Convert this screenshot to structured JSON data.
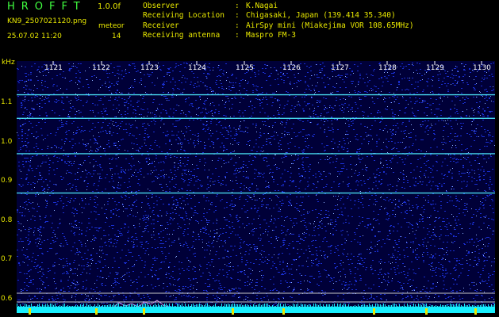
{
  "header": {
    "app_title": "HROFFT",
    "version": "1.0.0f",
    "filename": "KN9_2507021120.png",
    "datetime": "25.07.02 11:20",
    "meteor_label": "meteor",
    "meteor_count": "14"
  },
  "info": [
    {
      "key": "Observer",
      "value": "K.Nagai"
    },
    {
      "key": "Receiving Location",
      "value": "Chigasaki, Japan (139.414 35.340)"
    },
    {
      "key": "Receiver",
      "value": "AirSpy mini (Miakejima VOR 108.65MHz)"
    },
    {
      "key": "Receiving antenna",
      "value": "Maspro FM-3"
    }
  ],
  "plot": {
    "y_unit": "kHz",
    "x_ticks": [
      "1121",
      "1122",
      "1123",
      "1124",
      "1125",
      "1126",
      "1127",
      "1128",
      "1129",
      "1130"
    ],
    "y_ticks": [
      "1.1",
      "1.0",
      "0.9",
      "0.8",
      "0.7",
      "0.6"
    ],
    "signal_lines_khz": [
      1.115,
      1.055,
      0.965,
      0.865
    ],
    "noise_color": "#1a2fd0",
    "background_color": "#000038",
    "line_color": "#4ff0ff",
    "baseline_color": "#18f0ff"
  }
}
